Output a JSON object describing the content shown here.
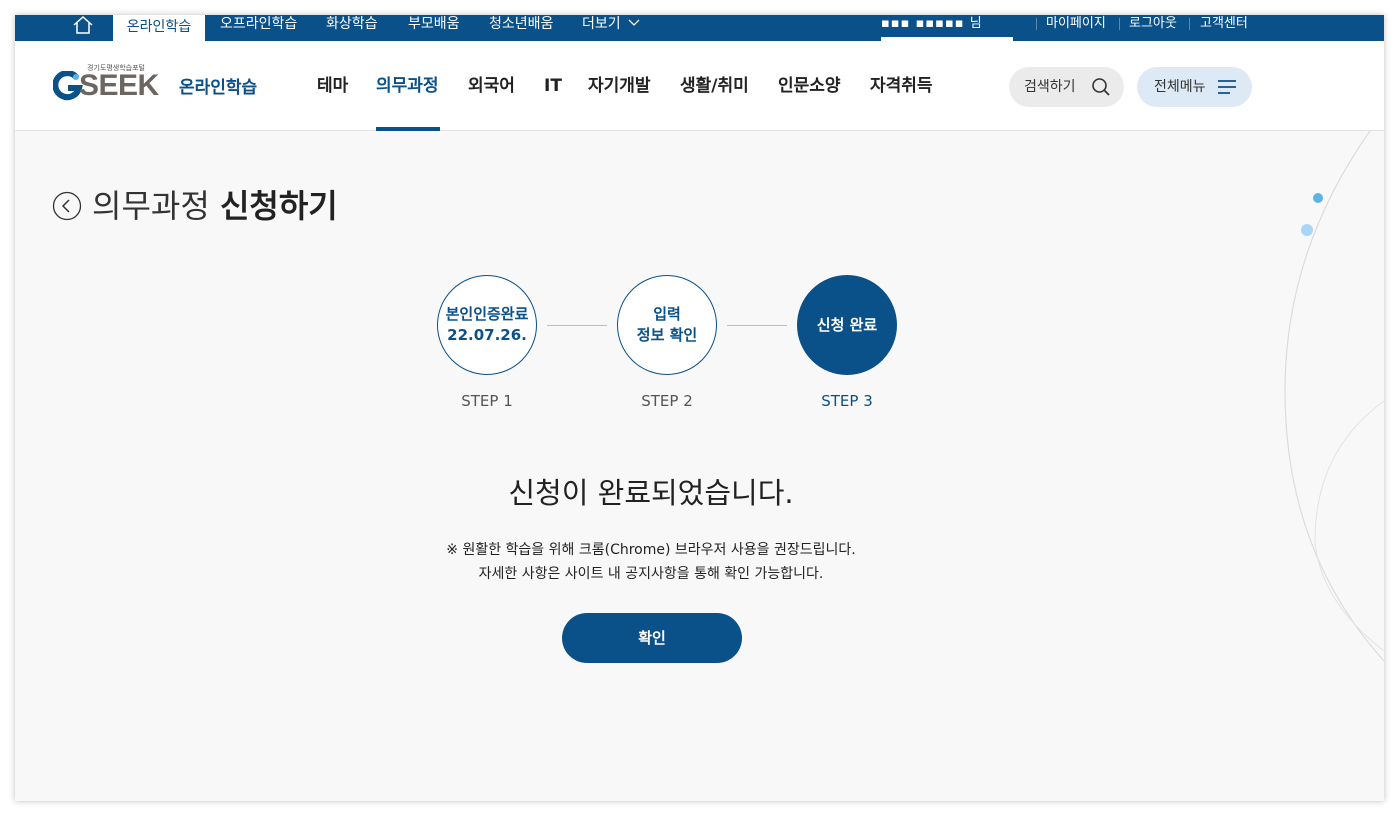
{
  "topbar": {
    "tabs": [
      "온라인학습",
      "오프라인학습",
      "화상학습",
      "부모배움",
      "청소년배움",
      "더보기"
    ],
    "user_name": "▪▪▪ ▪▪▪▪▪ 님",
    "links": [
      "마이페이지",
      "로그아웃",
      "고객센터"
    ]
  },
  "header": {
    "logo_tagline": "경기도평생학습포털",
    "logo_text": "SEEK",
    "logo_sub": "온라인학습",
    "nav": [
      "테마",
      "의무과정",
      "외국어",
      "IT",
      "자기개발",
      "생활/취미",
      "인문소양",
      "자격취득"
    ],
    "active_nav": "의무과정",
    "search_label": "검색하기",
    "menu_label": "전체메뉴"
  },
  "page": {
    "title_light": "의무과정",
    "title_bold": "신청하기",
    "steps": [
      {
        "circle": "본인인증완료\n22.07.26.",
        "label": "STEP 1"
      },
      {
        "circle": "입력\n정보 확인",
        "label": "STEP 2"
      },
      {
        "circle": "신청 완료",
        "label": "STEP 3"
      }
    ],
    "current_step": 3,
    "complete_message": "신청이 완료되었습니다.",
    "notice_line1": "※ 원활한 학습을 위해 크롬(Chrome) 브라우저 사용을 권장드립니다.",
    "notice_line2": "자세한 사항은 사이트 내 공지사항을 통해 확인 가능합니다.",
    "confirm_label": "확인"
  },
  "colors": {
    "brand": "#0a5089",
    "background": "#f8f8f8",
    "search_bg": "#ebebeb",
    "menu_bg": "#dde9f4",
    "accent_dot": "#5bb3ea"
  },
  "icons": [
    "home-icon",
    "chevron-down-icon",
    "search-icon",
    "hamburger-menu-icon",
    "back-arrow-icon"
  ]
}
